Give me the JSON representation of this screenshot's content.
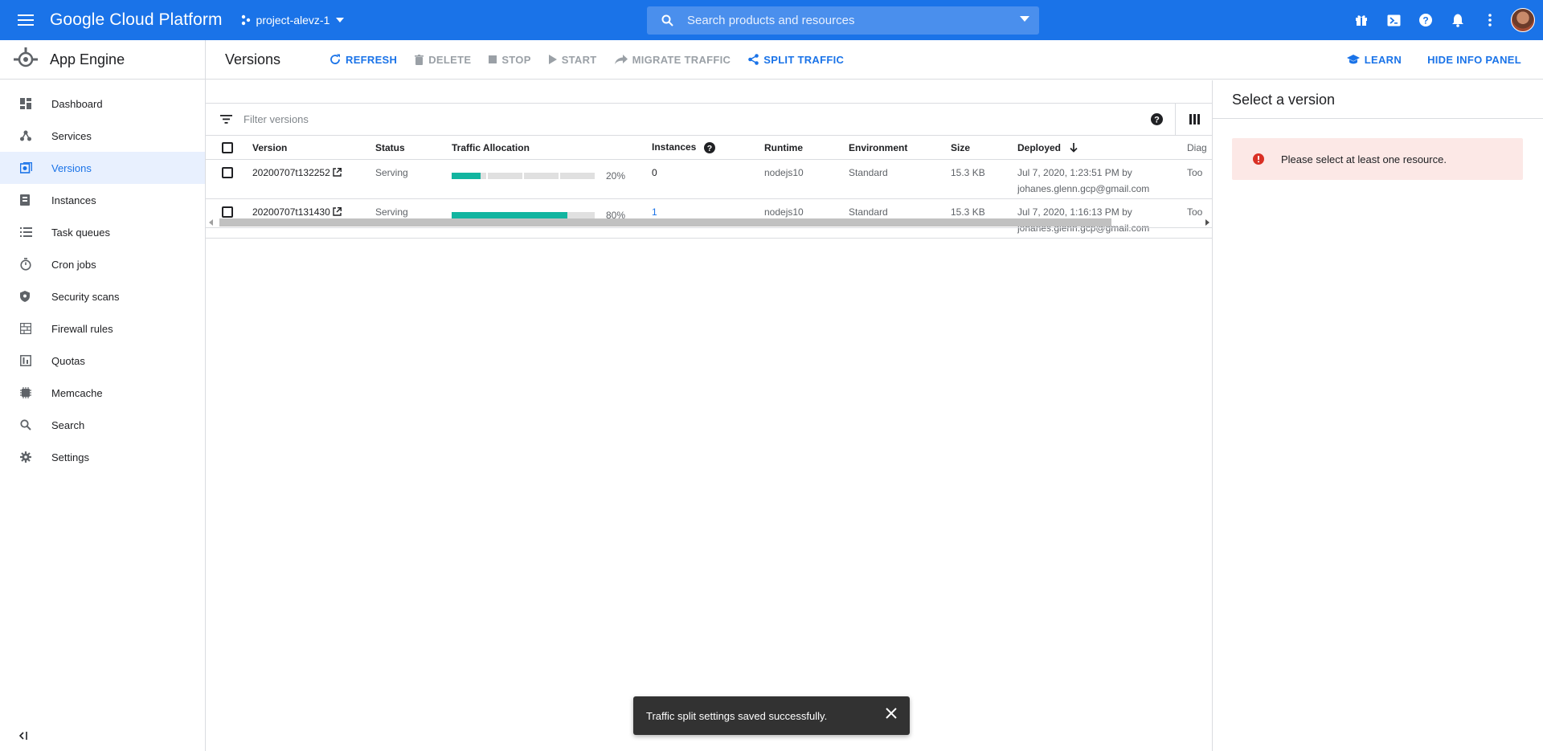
{
  "topbar": {
    "brand": "Google Cloud Platform",
    "project": "project-alevz-1",
    "search_placeholder": "Search products and resources",
    "accent_color": "#1a73e8"
  },
  "sidebar": {
    "title": "App Engine",
    "items": [
      {
        "label": "Dashboard",
        "icon": "dashboard-icon"
      },
      {
        "label": "Services",
        "icon": "services-icon"
      },
      {
        "label": "Versions",
        "icon": "versions-icon",
        "active": true
      },
      {
        "label": "Instances",
        "icon": "instances-icon"
      },
      {
        "label": "Task queues",
        "icon": "list-icon"
      },
      {
        "label": "Cron jobs",
        "icon": "timer-icon"
      },
      {
        "label": "Security scans",
        "icon": "shield-icon"
      },
      {
        "label": "Firewall rules",
        "icon": "firewall-icon"
      },
      {
        "label": "Quotas",
        "icon": "quota-icon"
      },
      {
        "label": "Memcache",
        "icon": "memcache-icon"
      },
      {
        "label": "Search",
        "icon": "search-icon"
      },
      {
        "label": "Settings",
        "icon": "gear-icon"
      }
    ]
  },
  "header": {
    "title": "Versions",
    "actions": {
      "refresh": "REFRESH",
      "delete": "DELETE",
      "stop": "STOP",
      "start": "START",
      "migrate": "MIGRATE TRAFFIC",
      "split": "SPLIT TRAFFIC"
    },
    "learn": "LEARN",
    "hide_panel": "HIDE INFO PANEL"
  },
  "filter": {
    "placeholder": "Filter versions"
  },
  "table": {
    "columns": {
      "version": "Version",
      "status": "Status",
      "traffic": "Traffic Allocation",
      "instances": "Instances",
      "runtime": "Runtime",
      "environment": "Environment",
      "size": "Size",
      "deployed": "Deployed",
      "diagnose": "Diag"
    },
    "rows": [
      {
        "version": "20200707t132252",
        "status": "Serving",
        "traffic_pct": 20,
        "traffic_label": "20%",
        "instances": "0",
        "runtime": "nodejs10",
        "environment": "Standard",
        "size": "15.3 KB",
        "deployed_line1": "Jul 7, 2020, 1:23:51 PM by",
        "deployed_line2": "johanes.glenn.gcp@gmail.com",
        "diagnose": "Too"
      },
      {
        "version": "20200707t131430",
        "status": "Serving",
        "traffic_pct": 80,
        "traffic_label": "80%",
        "instances": "1",
        "runtime": "nodejs10",
        "environment": "Standard",
        "size": "15.3 KB",
        "deployed_line1": "Jul 7, 2020, 1:16:13 PM by",
        "deployed_line2": "johanes.glenn.gcp@gmail.com",
        "diagnose": "Too"
      }
    ]
  },
  "info_panel": {
    "title": "Select a version",
    "alert": "Please select at least one resource."
  },
  "snackbar": {
    "message": "Traffic split settings saved successfully."
  }
}
